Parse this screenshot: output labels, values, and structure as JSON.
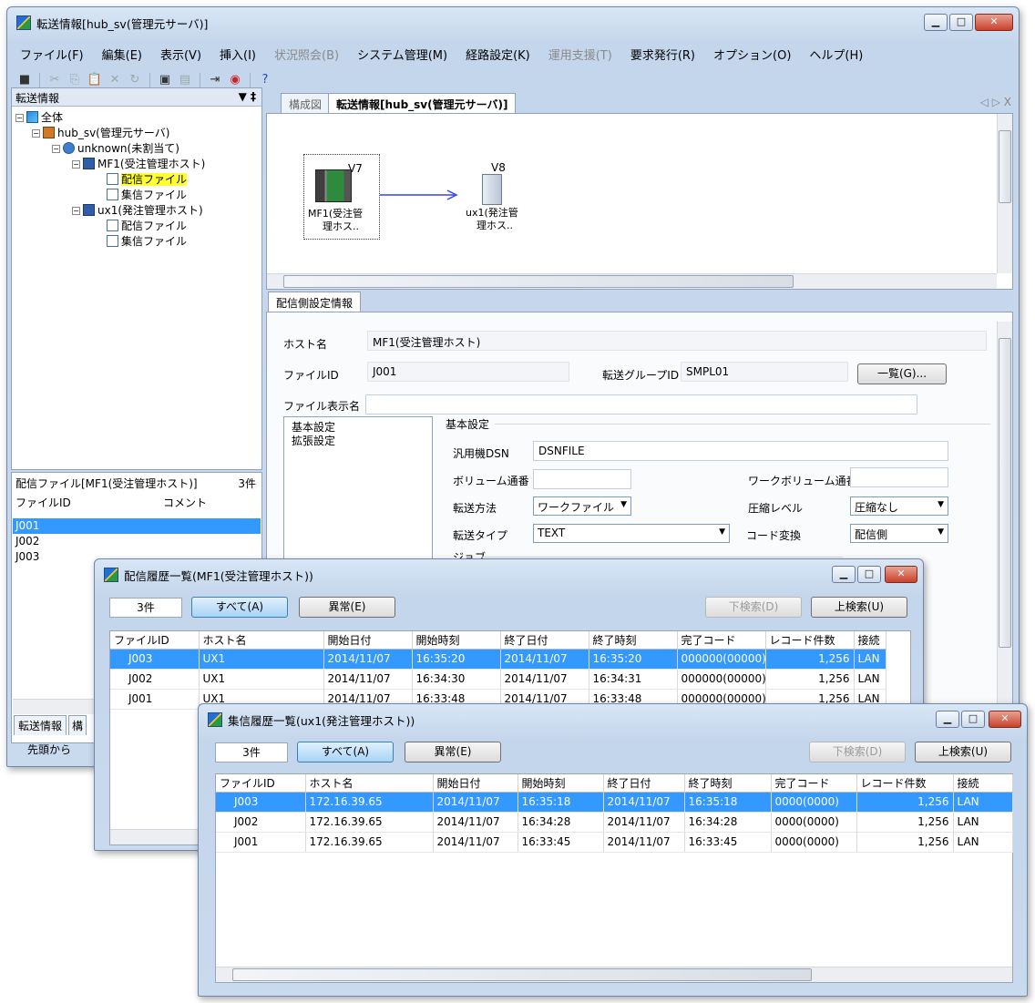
{
  "main": {
    "title": "転送情報[hub_sv(管理元サーバ)]",
    "menu": [
      {
        "label": "ファイル(F)",
        "disabled": false
      },
      {
        "label": "編集(E)",
        "disabled": false
      },
      {
        "label": "表示(V)",
        "disabled": false
      },
      {
        "label": "挿入(I)",
        "disabled": false
      },
      {
        "label": "状況照会(B)",
        "disabled": true
      },
      {
        "label": "システム管理(M)",
        "disabled": false
      },
      {
        "label": "経路設定(K)",
        "disabled": false
      },
      {
        "label": "運用支援(T)",
        "disabled": true
      },
      {
        "label": "要求発行(R)",
        "disabled": false
      },
      {
        "label": "オプション(O)",
        "disabled": false
      },
      {
        "label": "ヘルプ(H)",
        "disabled": false
      }
    ],
    "tree": {
      "header": "転送情報",
      "pin": "▼ ‡",
      "nodes": {
        "root": "全体",
        "server": "hub_sv(管理元サーバ)",
        "group": "unknown(未割当て)",
        "host1": "MF1(受注管理ホスト)",
        "host1_send": "配信ファイル",
        "host1_recv": "集信ファイル",
        "host2": "ux1(発注管理ホスト)",
        "host2_send": "配信ファイル",
        "host2_recv": "集信ファイル"
      }
    },
    "file_list": {
      "title": "配信ファイル[MF1(受注管理ホスト)]",
      "count": "3件",
      "columns": [
        "ファイルID",
        "コメント"
      ],
      "rows": [
        "J001",
        "J002",
        "J003"
      ],
      "bottom_tabs": [
        "転送情報",
        "構"
      ],
      "bottom_button": "先頭から"
    },
    "tabs": [
      "構成図",
      "転送情報[hub_sv(管理元サーバ)]"
    ],
    "diagram": {
      "host_a": {
        "version": "V7",
        "label1": "MF1(受注管",
        "label2": "理ホス.."
      },
      "host_b": {
        "version": "V8",
        "label1": "ux1(発注管",
        "label2": "理ホス.."
      }
    },
    "settings": {
      "tab": "配信側設定情報",
      "host_label": "ホスト名",
      "host_value": "MF1(受注管理ホスト)",
      "fileid_label": "ファイルID",
      "fileid_value": "J001",
      "group_label": "転送グループID",
      "group_value": "SMPL01",
      "list_button": "一覧(G)...",
      "display_name_label": "ファイル表示名",
      "display_name_value": "",
      "tree_items": [
        "基本設定",
        "拡張設定"
      ],
      "section": "基本設定",
      "dsn_label": "汎用機DSN",
      "dsn_value": "DSNFILE",
      "vol_label": "ボリューム通番",
      "vol_value": "",
      "workvol_label": "ワークボリューム通番",
      "workvol_value": "",
      "method_label": "転送方法",
      "method_value": "ワークファイル",
      "compress_label": "圧縮レベル",
      "compress_value": "圧縮なし",
      "type_label": "転送タイプ",
      "type_value": "TEXT",
      "code_label": "コード変換",
      "code_value": "配信側",
      "job_label": "ジョブ"
    }
  },
  "send_history": {
    "title": "配信履歴一覧(MF1(受注管理ホスト))",
    "count": "3件",
    "all_button": "すべて(A)",
    "error_button": "異常(E)",
    "down_button": "下検索(D)",
    "up_button": "上検索(U)",
    "columns": [
      "ファイルID",
      "ホスト名",
      "開始日付",
      "開始時刻",
      "終了日付",
      "終了時刻",
      "完了コード",
      "レコード件数",
      "接続"
    ],
    "rows": [
      [
        "J003",
        "UX1",
        "2014/11/07",
        "16:35:20",
        "2014/11/07",
        "16:35:20",
        "000000(00000)",
        "1,256",
        "LAN"
      ],
      [
        "J002",
        "UX1",
        "2014/11/07",
        "16:34:30",
        "2014/11/07",
        "16:34:31",
        "000000(00000)",
        "1,256",
        "LAN"
      ],
      [
        "J001",
        "UX1",
        "2014/11/07",
        "16:33:48",
        "2014/11/07",
        "16:33:48",
        "000000(00000)",
        "1,256",
        "LAN"
      ]
    ]
  },
  "recv_history": {
    "title": "集信履歴一覧(ux1(発注管理ホスト))",
    "count": "3件",
    "all_button": "すべて(A)",
    "error_button": "異常(E)",
    "down_button": "下検索(D)",
    "up_button": "上検索(U)",
    "columns": [
      "ファイルID",
      "ホスト名",
      "開始日付",
      "開始時刻",
      "終了日付",
      "終了時刻",
      "完了コード",
      "レコード件数",
      "接続"
    ],
    "rows": [
      [
        "J003",
        "172.16.39.65",
        "2014/11/07",
        "16:35:18",
        "2014/11/07",
        "16:35:18",
        "0000(0000)",
        "1,256",
        "LAN"
      ],
      [
        "J002",
        "172.16.39.65",
        "2014/11/07",
        "16:34:28",
        "2014/11/07",
        "16:34:28",
        "0000(0000)",
        "1,256",
        "LAN"
      ],
      [
        "J001",
        "172.16.39.65",
        "2014/11/07",
        "16:33:45",
        "2014/11/07",
        "16:33:45",
        "0000(0000)",
        "1,256",
        "LAN"
      ]
    ]
  },
  "colors": {
    "selection": "#3399ff",
    "highlight": "#ffff33",
    "arrow": "#3344ee"
  }
}
